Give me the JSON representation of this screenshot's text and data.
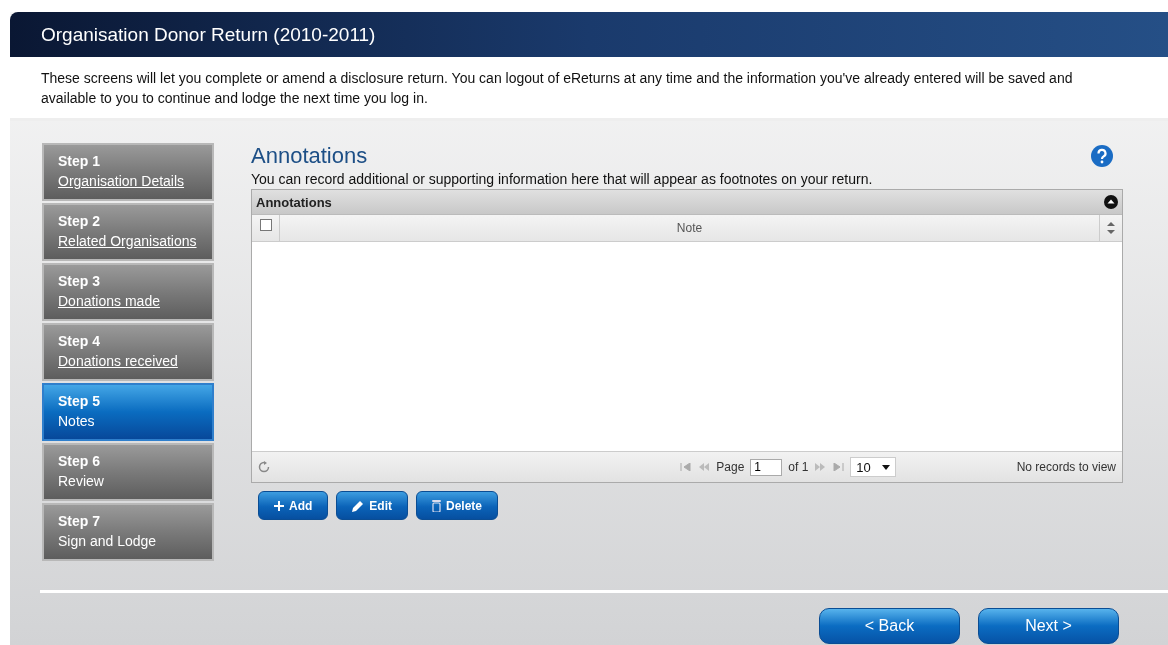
{
  "window": {
    "title": "Organisation Donor Return (2010-2011)"
  },
  "intro": "These screens will let you complete or amend a disclosure return. You can logout of eReturns at any time and the information you've already entered will be saved and available to you to continue and lodge the next time you log in.",
  "steps": [
    {
      "step": "Step 1",
      "label": "Organisation Details",
      "selected": false,
      "link": true
    },
    {
      "step": "Step 2",
      "label": "Related Organisations",
      "selected": false,
      "link": true
    },
    {
      "step": "Step 3",
      "label": "Donations made",
      "selected": false,
      "link": true
    },
    {
      "step": "Step 4",
      "label": "Donations received",
      "selected": false,
      "link": true
    },
    {
      "step": "Step 5",
      "label": "Notes",
      "selected": true,
      "link": false
    },
    {
      "step": "Step 6",
      "label": "Review",
      "selected": false,
      "link": false
    },
    {
      "step": "Step 7",
      "label": "Sign and Lodge",
      "selected": false,
      "link": false
    }
  ],
  "section": {
    "title": "Annotations",
    "description": "You can record additional or supporting information here that will appear as footnotes on your return."
  },
  "grid": {
    "caption": "Annotations",
    "select_all_checked": false,
    "columns": [
      "Note"
    ],
    "pager": {
      "page_label": "Page",
      "page": "1",
      "of_label": "of 1",
      "page_size": "10",
      "status": "No records to view"
    }
  },
  "grid_buttons": [
    {
      "kind": "add",
      "label": "Add"
    },
    {
      "kind": "edit",
      "label": "Edit"
    },
    {
      "kind": "delete",
      "label": "Delete"
    }
  ],
  "nav_buttons": [
    "< Back",
    "Next >"
  ]
}
